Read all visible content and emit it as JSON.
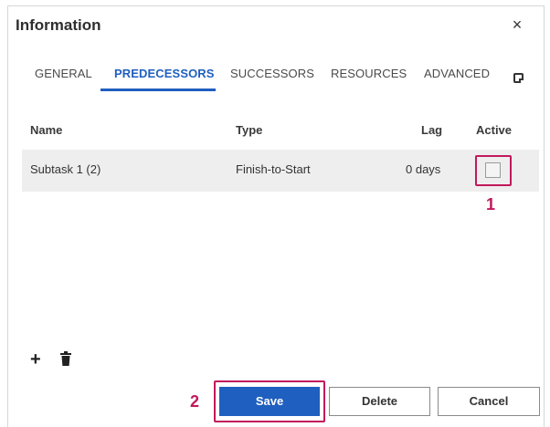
{
  "dialog": {
    "title": "Information",
    "close_icon": "×"
  },
  "tabs": [
    {
      "label": "GENERAL",
      "active": false
    },
    {
      "label": "PREDECESSORS",
      "active": true
    },
    {
      "label": "SUCCESSORS",
      "active": false
    },
    {
      "label": "RESOURCES",
      "active": false
    },
    {
      "label": "ADVANCED",
      "active": false
    }
  ],
  "table": {
    "columns": [
      "Name",
      "Type",
      "Lag",
      "Active"
    ],
    "rows": [
      {
        "name": "Subtask 1 (2)",
        "type": "Finish-to-Start",
        "lag": "0 days",
        "active": false
      }
    ]
  },
  "annotations": {
    "marker1": "1",
    "marker2": "2"
  },
  "footer": {
    "save_label": "Save",
    "delete_label": "Delete",
    "cancel_label": "Cancel"
  },
  "colors": {
    "accent": "#1f5fbf",
    "highlight": "#c2185b"
  },
  "icons": [
    "close-icon",
    "note-icon",
    "add-icon",
    "trash-icon",
    "checkbox"
  ]
}
